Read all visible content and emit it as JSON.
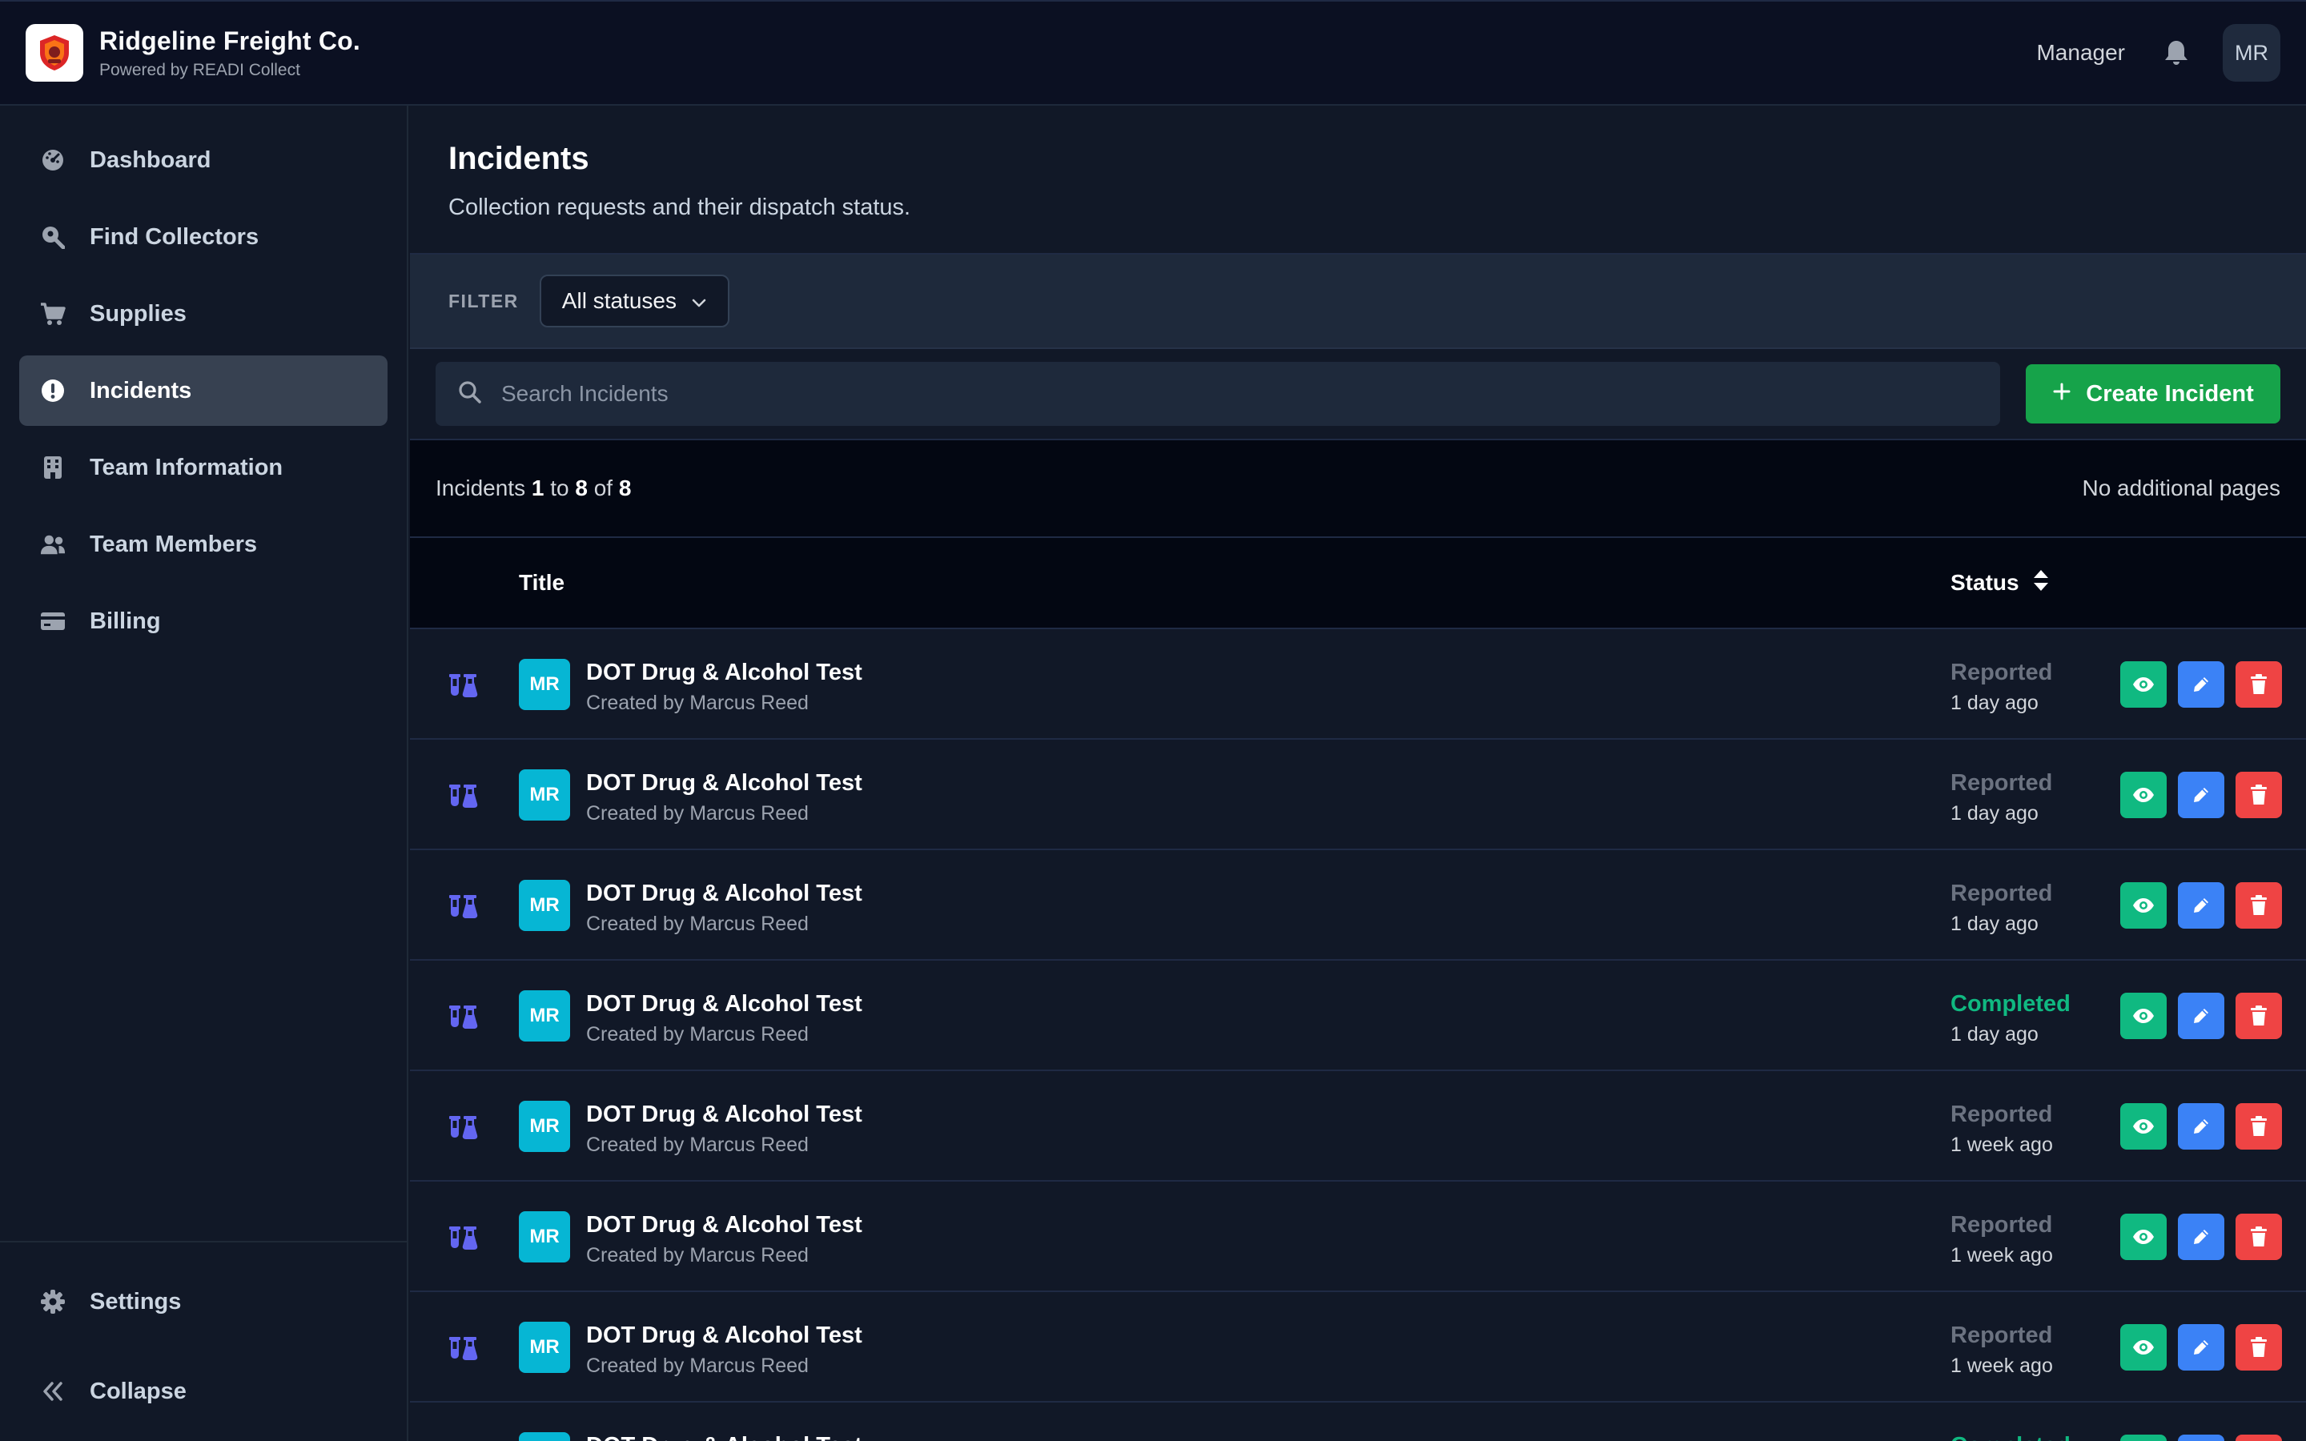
{
  "brand": {
    "name": "Ridgeline Freight Co.",
    "subtitle": "Powered by READI Collect"
  },
  "header": {
    "role": "Manager",
    "avatar_initials": "MR"
  },
  "sidebar": {
    "items": [
      {
        "label": "Dashboard",
        "icon": "dashboard-icon",
        "active": false
      },
      {
        "label": "Find Collectors",
        "icon": "search-location-icon",
        "active": false
      },
      {
        "label": "Supplies",
        "icon": "cart-icon",
        "active": false
      },
      {
        "label": "Incidents",
        "icon": "alert-circle-icon",
        "active": true
      },
      {
        "label": "Team Information",
        "icon": "building-icon",
        "active": false
      },
      {
        "label": "Team Members",
        "icon": "users-icon",
        "active": false
      },
      {
        "label": "Billing",
        "icon": "credit-card-icon",
        "active": false
      }
    ],
    "bottom": {
      "settings": "Settings",
      "collapse": "Collapse"
    }
  },
  "page": {
    "title": "Incidents",
    "description": "Collection requests and their dispatch status."
  },
  "filter": {
    "label": "FILTER",
    "selected": "All statuses"
  },
  "search": {
    "placeholder": "Search Incidents"
  },
  "actions": {
    "create_label": "Create Incident"
  },
  "pager": {
    "prefix": "Incidents",
    "from": "1",
    "to_word": "to",
    "to": "8",
    "of_word": "of",
    "total": "8",
    "right_text": "No additional pages"
  },
  "table": {
    "columns": {
      "title": "Title",
      "status": "Status"
    },
    "rows": [
      {
        "avatar": "MR",
        "title": "DOT Drug & Alcohol Test",
        "by": "Created by Marcus Reed",
        "status": "Reported",
        "status_kind": "reported",
        "time": "1 day ago"
      },
      {
        "avatar": "MR",
        "title": "DOT Drug & Alcohol Test",
        "by": "Created by Marcus Reed",
        "status": "Reported",
        "status_kind": "reported",
        "time": "1 day ago"
      },
      {
        "avatar": "MR",
        "title": "DOT Drug & Alcohol Test",
        "by": "Created by Marcus Reed",
        "status": "Reported",
        "status_kind": "reported",
        "time": "1 day ago"
      },
      {
        "avatar": "MR",
        "title": "DOT Drug & Alcohol Test",
        "by": "Created by Marcus Reed",
        "status": "Completed",
        "status_kind": "completed",
        "time": "1 day ago"
      },
      {
        "avatar": "MR",
        "title": "DOT Drug & Alcohol Test",
        "by": "Created by Marcus Reed",
        "status": "Reported",
        "status_kind": "reported",
        "time": "1 week ago"
      },
      {
        "avatar": "MR",
        "title": "DOT Drug & Alcohol Test",
        "by": "Created by Marcus Reed",
        "status": "Reported",
        "status_kind": "reported",
        "time": "1 week ago"
      },
      {
        "avatar": "MR",
        "title": "DOT Drug & Alcohol Test",
        "by": "Created by Marcus Reed",
        "status": "Reported",
        "status_kind": "reported",
        "time": "1 week ago"
      },
      {
        "avatar": "",
        "title": "DOT Drug & Alcohol Test",
        "by": "",
        "status": "Completed",
        "status_kind": "completed",
        "time": ""
      }
    ]
  },
  "colors": {
    "accent_green": "#16a34a",
    "status_completed": "#10b981",
    "status_reported": "#6b7280",
    "view": "#10b981",
    "edit": "#3b82f6",
    "delete": "#ef4444",
    "avatar": "#06b6d4",
    "row_icon": "#6366f1"
  }
}
